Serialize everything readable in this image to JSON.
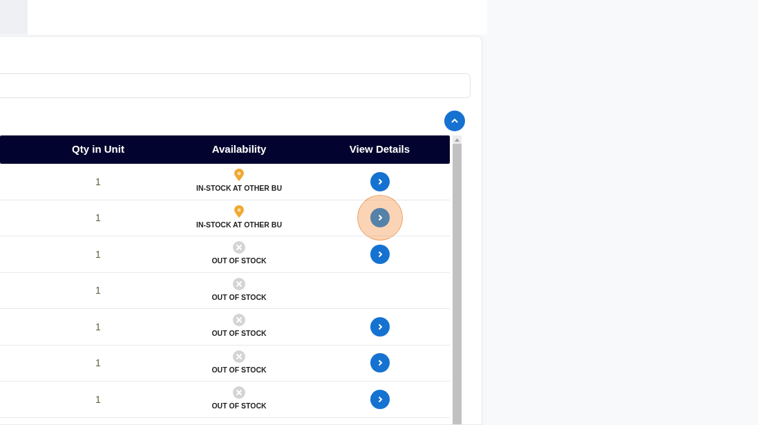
{
  "table": {
    "columns": [
      "Qty in Unit",
      "Availability",
      "View Details"
    ],
    "rows": [
      {
        "qty": "1",
        "availability": {
          "kind": "other_bu",
          "label": "IN-STOCK AT OTHER BU"
        },
        "details": true,
        "highlighted": false
      },
      {
        "qty": "1",
        "availability": {
          "kind": "other_bu",
          "label": "IN-STOCK AT OTHER BU"
        },
        "details": true,
        "highlighted": true
      },
      {
        "qty": "1",
        "availability": {
          "kind": "out",
          "label": "OUT OF STOCK"
        },
        "details": true,
        "highlighted": false
      },
      {
        "qty": "1",
        "availability": {
          "kind": "out",
          "label": "OUT OF STOCK"
        },
        "details": false,
        "highlighted": false
      },
      {
        "qty": "1",
        "availability": {
          "kind": "out",
          "label": "OUT OF STOCK"
        },
        "details": true,
        "highlighted": false
      },
      {
        "qty": "1",
        "availability": {
          "kind": "out",
          "label": "OUT OF STOCK"
        },
        "details": true,
        "highlighted": false
      },
      {
        "qty": "1",
        "availability": {
          "kind": "out",
          "label": "OUT OF STOCK"
        },
        "details": true,
        "highlighted": false
      }
    ]
  }
}
